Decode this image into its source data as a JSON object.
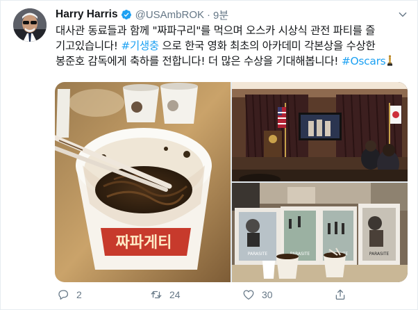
{
  "author": {
    "name": "Harry Harris",
    "handle": "@USAmbROK",
    "separator": "·",
    "time": "9분"
  },
  "tweet": {
    "lines": [
      [
        "대사관 동료들과 함께 \"짜파구리\"를 먹으며 오스카 시상식 관전 파티를 즐"
      ],
      [
        "기고있습니다! ",
        "#기생충",
        " 으로 한국 영화 최초의 아카데미 각본상을 수상한"
      ],
      [
        "봉준호 감독에게 축하를 전합니다! 더 많은 수상을 기대해봅니다! ",
        "#Oscars"
      ]
    ]
  },
  "media": {
    "photo1": {
      "cup_label": "짜파게티"
    },
    "photo3": {
      "poster_title": "PARASITE"
    }
  },
  "actions": {
    "reply_count": "2",
    "retweet_count": "24",
    "like_count": "30"
  },
  "colors": {
    "link": "#1da1f2",
    "secondary": "#657786",
    "text": "#14171a"
  }
}
